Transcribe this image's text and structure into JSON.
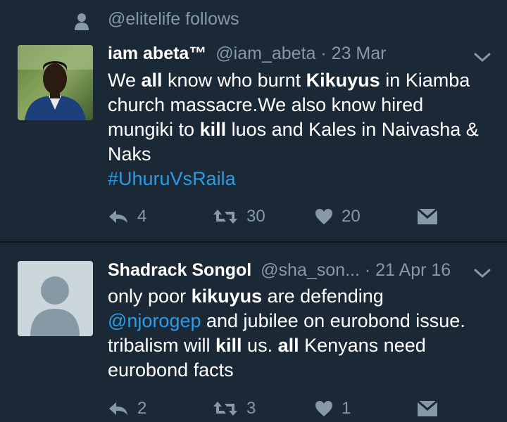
{
  "context": {
    "text": "@elitelife follows",
    "icon": "person-icon"
  },
  "tweets": [
    {
      "name": "iam abeta™",
      "handle": "@iam_abeta",
      "separator": "·",
      "date": "23 Mar",
      "text_parts": [
        "We ",
        "all",
        " know who burnt ",
        "Kikuyus",
        " in Kiamba church massacre.We also know hired mungiki to ",
        "kill",
        " luos and Kales in Naivasha & Naks",
        "#UhuruVsRaila"
      ],
      "replies": "4",
      "retweets": "30",
      "likes": "20"
    },
    {
      "name": "Shadrack Songol",
      "handle": "@sha_son...",
      "separator": "·",
      "date": "21 Apr 16",
      "text_parts": [
        "only poor ",
        "kikuyus",
        " are defending ",
        "@njorogep",
        " and jubilee on eurobond issue. tribalism will ",
        "kill",
        " us. ",
        "all",
        " Kenyans need eurobond facts"
      ],
      "replies": "2",
      "retweets": "3",
      "likes": "1"
    }
  ],
  "colors": {
    "background": "#1b2836",
    "text": "#ffffff",
    "muted": "#8899a6",
    "link": "#2b9be8",
    "divider": "#10171e"
  }
}
